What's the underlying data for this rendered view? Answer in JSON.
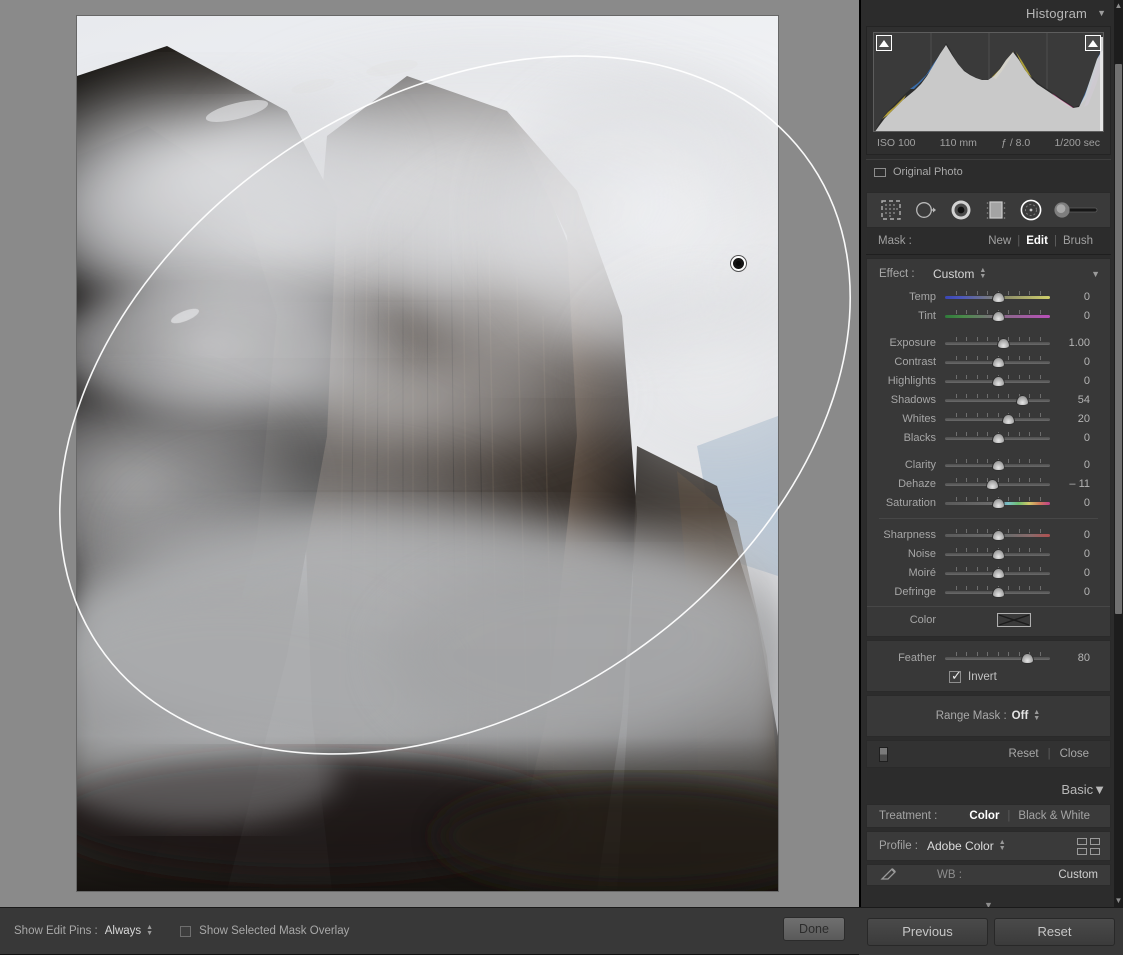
{
  "histogram": {
    "title": "Histogram",
    "collapse_icon": "triangle-down-icon",
    "shadow_clip_icon": "shadow-clipping-triangle-icon",
    "highlight_clip_icon": "highlight-clipping-triangle-icon",
    "meta": {
      "iso": "ISO 100",
      "focal_length": "110 mm",
      "aperture": "ƒ / 8.0",
      "shutter": "1/200 sec"
    },
    "original_photo_label": "Original Photo"
  },
  "tools": [
    {
      "name": "mask-tool-graduated-grid",
      "icon": "dotted-square-icon"
    },
    {
      "name": "mask-tool-graduated-filter",
      "icon": "circle-arrow-icon"
    },
    {
      "name": "mask-tool-radial-filter",
      "icon": "filled-radial-icon",
      "selected": true
    },
    {
      "name": "mask-tool-linear-gradient",
      "icon": "rectangle-gradient-icon"
    },
    {
      "name": "mask-tool-brush-circle",
      "icon": "circle-outline-icon"
    },
    {
      "name": "mask-tool-brush-size",
      "icon": "brush-slider-icon"
    }
  ],
  "mask_row": {
    "label": "Mask :",
    "options": [
      "New",
      "Edit",
      "Brush"
    ],
    "active": "Edit",
    "separator": "|"
  },
  "effect": {
    "label": "Effect :",
    "value": "Custom",
    "stepper_icon": "up-down-stepper-icon",
    "collapse_icon": "triangle-down-icon"
  },
  "sliders": [
    {
      "name": "Temp",
      "value": "0",
      "pos": 50,
      "rail": "grad-temp"
    },
    {
      "name": "Tint",
      "value": "0",
      "pos": 50,
      "rail": "grad-tint"
    },
    {
      "name": "Exposure",
      "value": "1.00",
      "pos": 55,
      "rail": "plain"
    },
    {
      "name": "Contrast",
      "value": "0",
      "pos": 50,
      "rail": "plain"
    },
    {
      "name": "Highlights",
      "value": "0",
      "pos": 50,
      "rail": "plain"
    },
    {
      "name": "Shadows",
      "value": "54",
      "pos": 73,
      "rail": "plain"
    },
    {
      "name": "Whites",
      "value": "20",
      "pos": 60,
      "rail": "plain"
    },
    {
      "name": "Blacks",
      "value": "0",
      "pos": 50,
      "rail": "plain"
    },
    {
      "name": "Clarity",
      "value": "0",
      "pos": 50,
      "rail": "plain"
    },
    {
      "name": "Dehaze",
      "value": "– 11",
      "pos": 45,
      "rail": "plain"
    },
    {
      "name": "Saturation",
      "value": "0",
      "pos": 50,
      "rail": "grad-sat"
    },
    {
      "name": "Sharpness",
      "value": "0",
      "pos": 50,
      "rail": "grad-sharp"
    },
    {
      "name": "Noise",
      "value": "0",
      "pos": 50,
      "rail": "plain"
    },
    {
      "name": "Moiré",
      "value": "0",
      "pos": 50,
      "rail": "plain"
    },
    {
      "name": "Defringe",
      "value": "0",
      "pos": 50,
      "rail": "plain"
    }
  ],
  "color": {
    "label": "Color",
    "swatch_icon": "empty-color-swatch-icon"
  },
  "feather": {
    "name": "Feather",
    "value": "80",
    "pos": 78
  },
  "invert": {
    "label": "Invert",
    "checked": true
  },
  "range_mask": {
    "label": "Range Mask :",
    "value": "Off",
    "stepper_icon": "up-down-stepper-icon"
  },
  "reset_close": {
    "switch_icon": "toggle-switch-icon",
    "reset_label": "Reset",
    "separator": "|",
    "close_label": "Close"
  },
  "basic": {
    "title": "Basic",
    "collapse_icon": "triangle-down-icon",
    "treatment": {
      "label": "Treatment :",
      "options": [
        "Color",
        "Black & White"
      ],
      "active": "Color",
      "separator": "|"
    },
    "profile": {
      "label": "Profile :",
      "value": "Adobe Color",
      "stepper_icon": "up-down-stepper-icon",
      "grid_icon": "profile-browser-grid-icon"
    },
    "wb": {
      "eyedropper_icon": "white-balance-eyedropper-icon",
      "label": "WB :",
      "value": "Custom"
    }
  },
  "toolbar": {
    "show_edit_pins_label": "Show Edit Pins :",
    "show_edit_pins_value": "Always",
    "stepper_icon": "up-down-stepper-icon",
    "mask_overlay_label": "Show Selected Mask Overlay",
    "mask_overlay_checked": false,
    "done_label": "Done"
  },
  "bottom_buttons": {
    "previous_label": "Previous",
    "reset_label": "Reset"
  },
  "canvas": {
    "mask_shape": "radial-gradient-ellipse",
    "pin_label": "mask-edit-pin"
  },
  "colors": {
    "canvas_bg": "#8a8a8a",
    "panel_bg": "#2c2c2c",
    "section_bg": "#383838",
    "accent_text": "#ffffff",
    "body_text": "#a6a6a6",
    "toolbar_bg": "#383838"
  }
}
